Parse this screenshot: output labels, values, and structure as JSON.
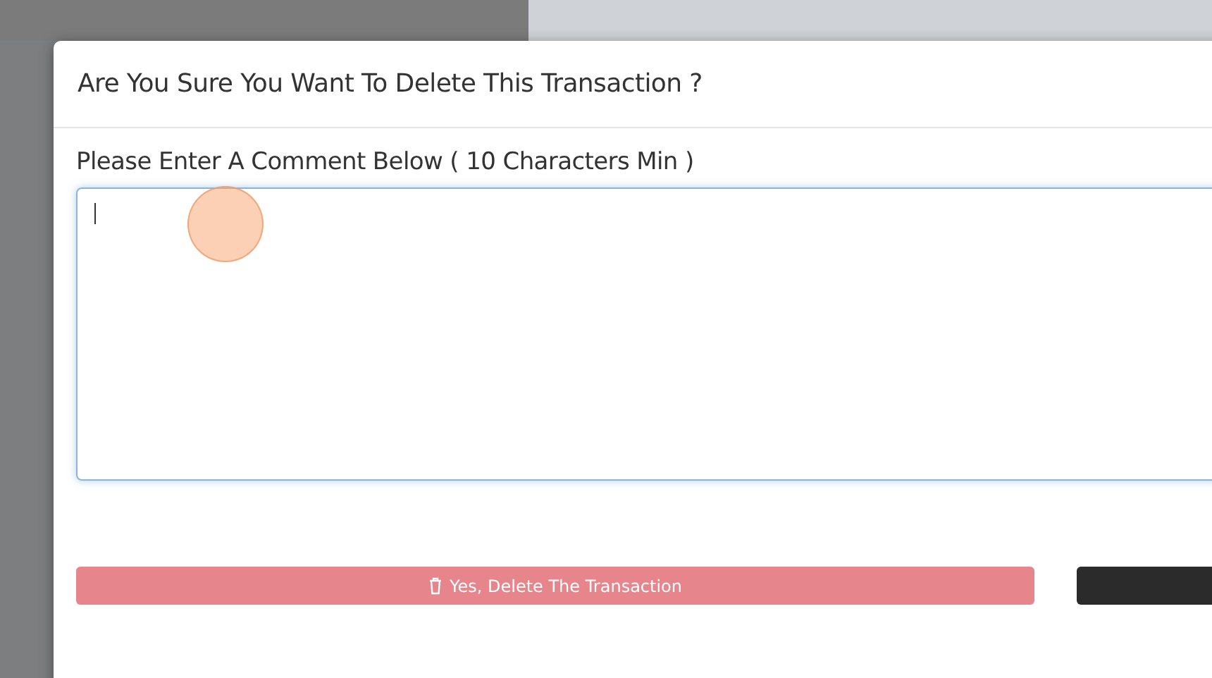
{
  "dialog": {
    "title": "Are You Sure You Want To Delete This Transaction ?",
    "comment_label": "Please Enter A Comment Below ( 10 Characters Min )",
    "comment_field": {
      "focused": true
    },
    "buttons": [
      {
        "kind": "danger",
        "label": "Yes, Delete The Transaction"
      },
      {
        "kind": "dark"
      }
    ]
  }
}
